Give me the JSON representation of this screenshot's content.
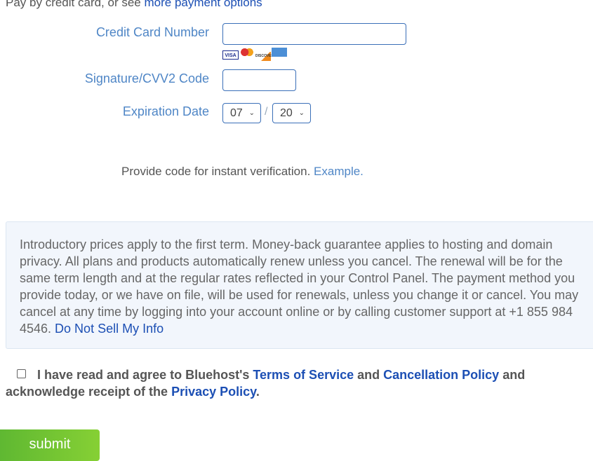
{
  "intro": {
    "text": "Pay by credit card, or see ",
    "link": "more payment options"
  },
  "fields": {
    "cc_label": "Credit Card Number",
    "cvv_label": "Signature/CVV2 Code",
    "exp_label": "Expiration Date",
    "exp_month": "07",
    "exp_year": "20",
    "sep": "/"
  },
  "cards": [
    "VISA",
    "MasterCard",
    "DISCOVER",
    "AMERICAN EXPRESS"
  ],
  "verify": {
    "text": "Provide code for instant verification. ",
    "link": "Example."
  },
  "notice": {
    "text": "Introductory prices apply to the first term. Money-back guarantee applies to hosting and domain privacy. All plans and products automatically renew unless you cancel. The renewal will be for the same term length and at the regular rates reflected in your Control Panel. The payment method you provide today, or we have on file, will be used for renewals, unless you change it or cancel. You may cancel at any time by logging into your account online or by calling customer support at +1 855 984 4546. ",
    "link": "Do Not Sell My Info"
  },
  "agree": {
    "t1": "I have read and agree to Bluehost's ",
    "tos": "Terms of Service",
    "t2": " and ",
    "cancel": "Cancellation Policy",
    "t3": " and acknowledge receipt of the ",
    "privacy": "Privacy Policy",
    "t4": "."
  },
  "submit": "submit"
}
